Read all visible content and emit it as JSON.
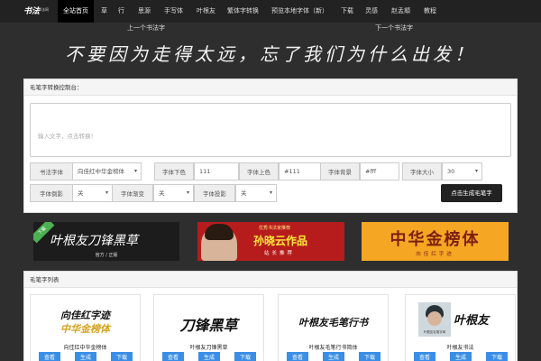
{
  "colors": {
    "topbar": "#222222",
    "page_bg": "#2e2e2e",
    "button_blue": "#3a8ee6",
    "generate_btn": "#222222"
  },
  "header": {
    "logo_main": "书法",
    "logo_sub": "书法网",
    "nav": [
      "全站首页",
      "草",
      "行",
      "思源",
      "手写体",
      "叶根友",
      "繁体字转换",
      "预览本地字体（新）",
      "下载",
      "灵感",
      "赵孟頫",
      "教程"
    ],
    "prev_link": "上一个书法字",
    "next_link": "下一个书法字"
  },
  "slogan": "不要因为走得太远，忘了我们为什么出发！",
  "console": {
    "title": "毛笔字转换控制台：",
    "placeholder": "输入文字，点击转换！",
    "labels": {
      "font": "书法字体",
      "fg": "字体下色",
      "upper": "字体上色",
      "bg": "字体背景",
      "size": "字体大小",
      "tilt": "字体倒影",
      "gradient": "字体渐变",
      "shadow": "字体投影"
    },
    "values": {
      "font": "向佳红中华金榜体",
      "fg": "111",
      "upper": "#111",
      "bg": "#fff",
      "size": "30",
      "tilt": "关",
      "gradient": "关",
      "shadow": "关"
    },
    "generate": "点击生成毛笔字"
  },
  "banners": {
    "b1": {
      "tag": "下载",
      "title": "叶根友刀锋黑草",
      "sub": "官方 / 正版"
    },
    "b2": {
      "small": "优秀书法家推荐",
      "title": "孙晓云作品",
      "sub": "站长推荐"
    },
    "b3": {
      "title": "中华金榜体",
      "sub": "向佳红字迹"
    }
  },
  "list": {
    "title": "毛笔字列表",
    "buttons": {
      "view": "查看",
      "make": "生成",
      "download": "下载"
    },
    "cards": [
      {
        "name": "向佳红中华金榜体",
        "art1": "向佳红字迹",
        "art2": "中华金榜体"
      },
      {
        "name": "叶根友刀锋黑草",
        "art1": "刀锋黑草",
        "art2": ""
      },
      {
        "name": "叶根友毛笔行书简体",
        "art1": "叶根友毛笔行书",
        "art2": ""
      },
      {
        "name": "叶根友书法",
        "art1": "叶根友",
        "art2": "叶根友毛笔字体"
      }
    ]
  }
}
